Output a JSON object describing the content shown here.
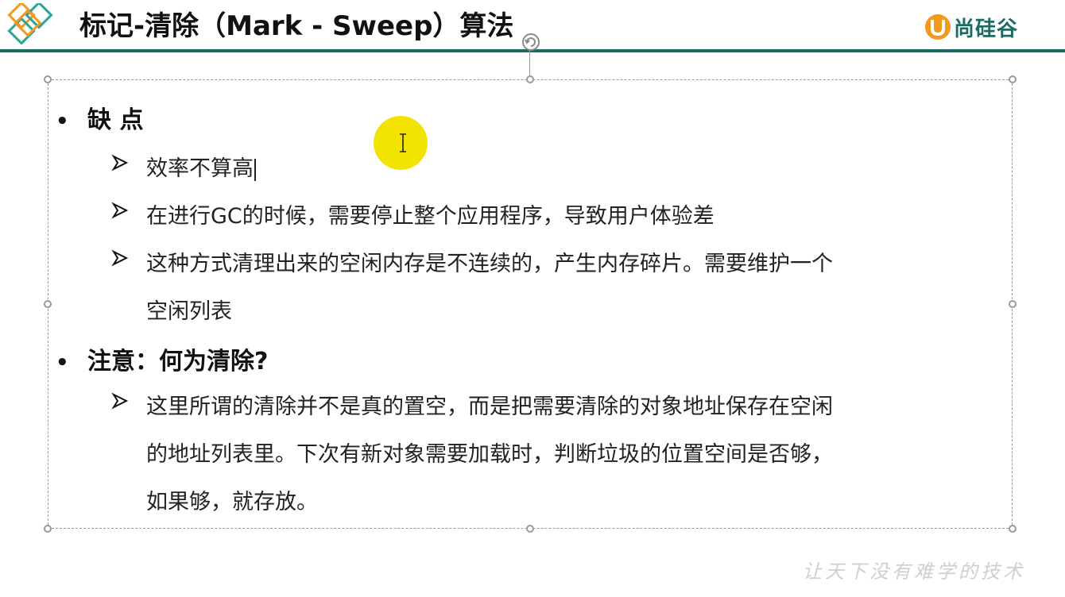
{
  "slide": {
    "title": "标记-清除（Mark - Sweep）算法",
    "brand": "尚硅谷",
    "watermark": "让天下没有难学的技术"
  },
  "content": {
    "section1": {
      "heading": "缺 点",
      "items": [
        {
          "text": "效率不算高"
        },
        {
          "text": "在进行GC的时候，需要停止整个应用程序，导致用户体验差"
        },
        {
          "line1": "这种方式清理出来的空闲内存是不连续的，产生内存碎片。需要维护一个",
          "line2": "空闲列表"
        }
      ]
    },
    "section2": {
      "heading": "注意：何为清除?",
      "items": [
        {
          "line1": "这里所谓的清除并不是真的置空，而是把需要清除的对象地址保存在空闲",
          "line2": "的地址列表里。下次有新对象需要加载时，判断垃圾的位置空间是否够，",
          "line3": "如果够，就存放。"
        }
      ]
    }
  },
  "colors": {
    "accent": "#1c6b63",
    "cursor_highlight": "#f2e400",
    "logo_orange": "#f29a1e",
    "logo_teal": "#2aa597"
  },
  "icons": {
    "logo": "diamond-logo-icon",
    "rotate": "rotate-handle-icon",
    "bullet_arrow": "arrow-bullet-icon",
    "cursor": "text-cursor-icon"
  }
}
